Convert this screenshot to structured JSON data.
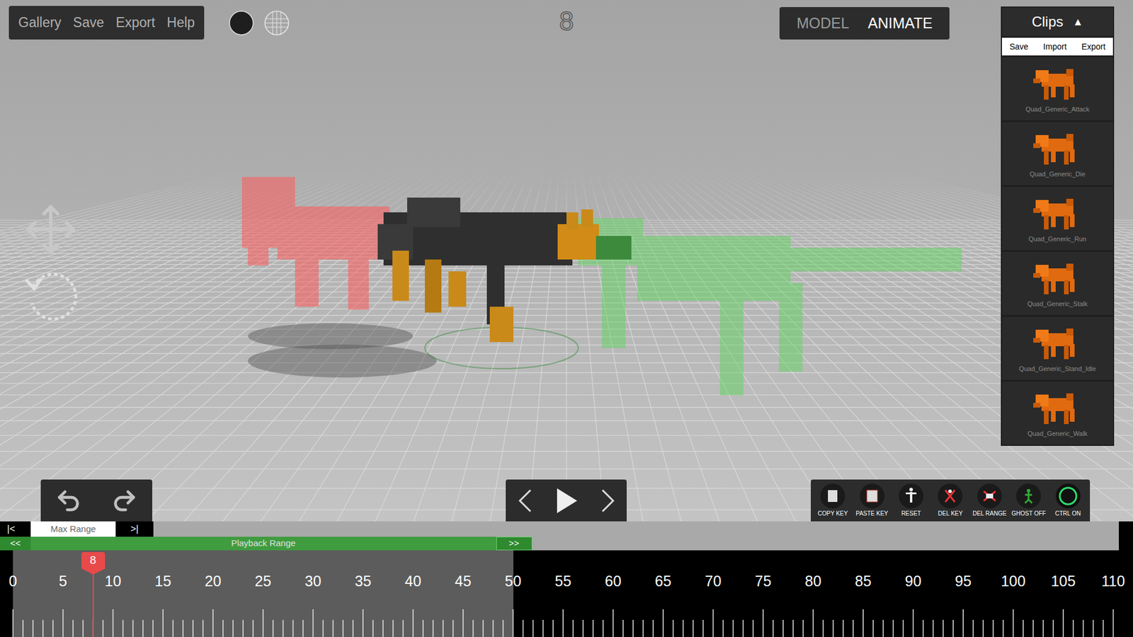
{
  "menu": [
    "Gallery",
    "Save",
    "Export",
    "Help"
  ],
  "frame_display": "8",
  "modes": [
    {
      "label": "MODEL",
      "selected": false
    },
    {
      "label": "ANIMATE",
      "selected": true
    }
  ],
  "clips": {
    "title": "Clips",
    "toggle": "▲",
    "actions": [
      "Save",
      "Import",
      "Export"
    ],
    "items": [
      "Quad_Generic_Attack",
      "Quad_Generic_Die",
      "Quad_Generic_Run",
      "Quad_Generic_Stalk",
      "Quad_Generic_Stand_Idle",
      "Quad_Generic_Walk"
    ]
  },
  "tools": [
    {
      "label": "COPY KEY",
      "kind": "copy"
    },
    {
      "label": "PASTE KEY",
      "kind": "paste"
    },
    {
      "label": "RESET",
      "kind": "reset"
    },
    {
      "label": "DEL KEY",
      "kind": "delkey"
    },
    {
      "label": "DEL RANGE",
      "kind": "delrange"
    },
    {
      "label": "GHOST OFF",
      "kind": "ghost"
    },
    {
      "label": "CTRL ON",
      "kind": "ctrl"
    }
  ],
  "timeline": {
    "max_range": {
      "start_button": "|<",
      "label": "Max Range",
      "end_button": ">|"
    },
    "playback_range": {
      "start_button": "<<",
      "label": "Playback Range",
      "end_button": ">>",
      "start": 0,
      "end": 50
    },
    "ruler_labels": [
      "0",
      "5",
      "10",
      "15",
      "20",
      "25",
      "30",
      "35",
      "40",
      "45",
      "50",
      "55",
      "60",
      "65",
      "70",
      "75",
      "80",
      "85",
      "90",
      "95",
      "100",
      "105",
      "110"
    ],
    "current_frame": "8"
  }
}
